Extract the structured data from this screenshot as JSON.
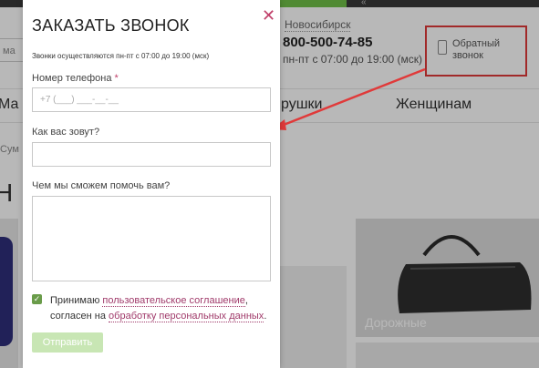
{
  "background": {
    "city": "Новосибирск",
    "phone": "800-500-74-85",
    "hours": "пн-пт с 07:00 до 19:00 (мск)",
    "callback_label": "Обратный звонок",
    "search_fragment": "ма",
    "nav": [
      "Ма",
      "рушки",
      "Женщинам"
    ],
    "breadcrumb_fragment": "Сум",
    "heading_fragment": "Н",
    "product_caption": "Дорожные"
  },
  "modal": {
    "title": "ЗАКАЗАТЬ ЗВОНОК",
    "close_glyph": "✕",
    "note": "Звонки осуществляются пн-пт с 07:00 до 19:00 (мск)",
    "phone_label": "Номер телефона",
    "required_mark": "*",
    "phone_placeholder": "+7 (___) ___-__-__",
    "name_label": "Как вас зовут?",
    "name_value": "",
    "help_label": "Чем мы сможем помочь вам?",
    "help_value": "",
    "agree_prefix": "Принимаю ",
    "agree_link1": "пользовательское соглашение",
    "agree_mid": ", согласен на ",
    "agree_link2": "обработку персональных данных",
    "agree_suffix": ".",
    "submit_label": "Отправить"
  },
  "colors": {
    "accent": "#c0406a",
    "annotation_red": "#e03a3a",
    "checkbox_green": "#6a9c4a",
    "submit_disabled": "#c8e6b4"
  }
}
